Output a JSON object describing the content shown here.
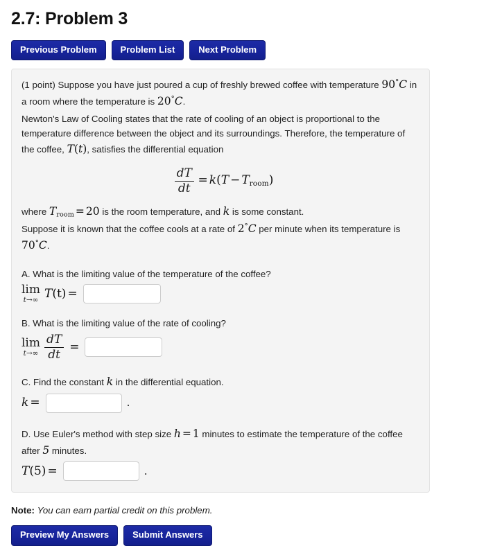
{
  "page": {
    "title": "2.7: Problem 3"
  },
  "nav": {
    "previous_label": "Previous Problem",
    "problem_list_label": "Problem List",
    "next_label": "Next Problem"
  },
  "problem": {
    "points": "(1 point)",
    "intro_1": "Suppose you have just poured a cup of freshly brewed coffee with temperature",
    "temp_initial": "90",
    "temp_initial_unit": "C",
    "intro_2": "in a room where the temperature is",
    "temp_room_value": "20",
    "temp_room_unit": "C",
    "intro_3": ".",
    "law_text": "Newton's Law of Cooling states that the rate of cooling of an object is proportional to the temperature difference between the object and its surroundings. Therefore, the temperature of the coffee,",
    "function_symbol": "T",
    "function_arg": "t",
    "law_text_end": ", satisfies the differential equation",
    "equation": {
      "numerator": "dT",
      "denominator": "dt",
      "equals": "=",
      "rhs_k": "k",
      "rhs_open": "(",
      "rhs_T": "T",
      "rhs_minus": "−",
      "rhs_Troom": "T",
      "rhs_sub": "room",
      "rhs_close": ")"
    },
    "where_1": "where",
    "where_Troom": "T",
    "where_Troom_sub": "room",
    "where_equals": "=",
    "where_value": "20",
    "where_2": "is the room temperature, and",
    "where_k": "k",
    "where_3": "is some constant.",
    "rate_1": "Suppose it is known that the coffee cools at a rate of",
    "rate_value": "2",
    "rate_unit": "C",
    "rate_2": "per minute when its temperature is",
    "rate_temp": "70",
    "rate_temp_unit": "C",
    "rate_3": "."
  },
  "questions": {
    "a": {
      "prompt": "A. What is the limiting value of the temperature of the coffee?",
      "lim_label": "lim",
      "lim_sub": "t→∞",
      "expr_T": "T",
      "expr_arg": "(t)",
      "equals": "=",
      "answer_value": ""
    },
    "b": {
      "prompt": "B. What is the limiting value of the rate of cooling?",
      "lim_label": "lim",
      "lim_sub": "t→∞",
      "frac_num": "dT",
      "frac_den": "dt",
      "equals": "=",
      "answer_value": ""
    },
    "c": {
      "prompt_1": "C. Find the constant",
      "prompt_symbol": "k",
      "prompt_2": "in the differential equation.",
      "label_k": "k",
      "equals": "=",
      "answer_value": "",
      "trailing": "."
    },
    "d": {
      "prompt_1": "D. Use Euler's method with step size",
      "step_symbol": "h",
      "step_equals": "=",
      "step_value": "1",
      "prompt_2": "minutes to estimate the temperature of the coffee after",
      "minutes_value": "5",
      "prompt_3": "minutes.",
      "label_T": "T",
      "label_arg": "(5)",
      "equals": "=",
      "answer_value": "",
      "trailing": "."
    }
  },
  "note": {
    "label": "Note:",
    "text": "You can earn partial credit on this problem."
  },
  "footer": {
    "preview_label": "Preview My Answers",
    "submit_label": "Submit Answers"
  },
  "colors": {
    "button_blue": "#17249b",
    "panel_bg": "#f4f4f4",
    "panel_border": "#e2e2e2",
    "input_border": "#cccccc"
  }
}
